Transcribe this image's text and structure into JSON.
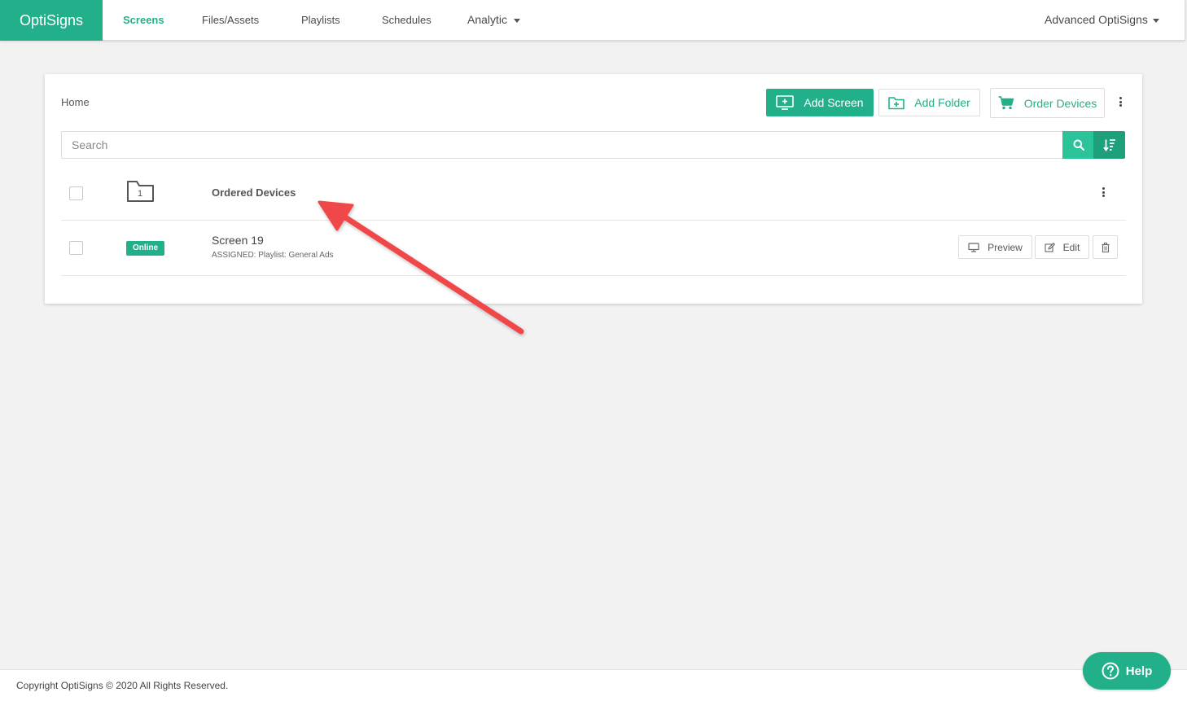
{
  "app": {
    "brand": "OptiSigns",
    "accent_color": "#22b08a"
  },
  "nav": {
    "items": [
      {
        "label": "Screens",
        "active": true
      },
      {
        "label": "Files/Assets",
        "active": false
      },
      {
        "label": "Playlists",
        "active": false
      },
      {
        "label": "Schedules",
        "active": false
      },
      {
        "label": "Analytic",
        "active": false,
        "dropdown": true
      }
    ],
    "account": "Advanced OptiSigns"
  },
  "toolbar": {
    "breadcrumb": "Home",
    "add_screen_label": "Add Screen",
    "add_folder_label": "Add Folder",
    "order_devices_label": "Order Devices"
  },
  "search": {
    "placeholder": "Search",
    "value": ""
  },
  "list": {
    "folder": {
      "name": "Ordered Devices",
      "count": "1",
      "icon": "folder-icon"
    },
    "screen": {
      "name": "Screen 19",
      "status": "Online",
      "status_color": "#22b08a",
      "assignment": "ASSIGNED: Playlist: General Ads",
      "preview_label": "Preview",
      "edit_label": "Edit"
    }
  },
  "footer": {
    "copyright": "Copyright OptiSigns © 2020 All Rights Reserved."
  },
  "help": {
    "label": "Help"
  },
  "annotation": {
    "arrow_color": "#f0474a"
  }
}
